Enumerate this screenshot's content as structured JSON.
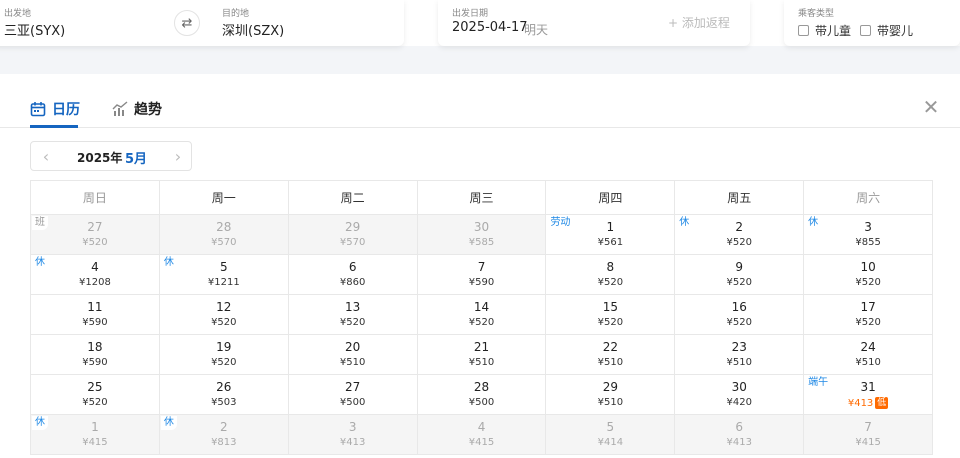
{
  "search": {
    "from_label": "出发地",
    "from_value": "三亚(SYX)",
    "to_label": "目的地",
    "to_value": "深圳(SZX)",
    "date_label": "出发日期",
    "date_value": "2025-04-17",
    "date_sub": "明天",
    "add_return": "+ 添加返程",
    "pax_label": "乘客类型",
    "pax_child": "带儿童",
    "pax_infant": "带婴儿"
  },
  "tabs": [
    {
      "label": "日历",
      "icon": "calendar-icon",
      "active": true
    },
    {
      "label": "趋势",
      "icon": "trend-icon",
      "active": false
    }
  ],
  "month_nav": {
    "year": "2025年",
    "month": "5月"
  },
  "weekdays": [
    "周日",
    "周一",
    "周二",
    "周三",
    "周四",
    "周五",
    "周六"
  ],
  "weeks": [
    [
      {
        "day": "27",
        "price": "¥520",
        "other": true,
        "tag": "班",
        "tagType": "work"
      },
      {
        "day": "28",
        "price": "¥570",
        "other": true
      },
      {
        "day": "29",
        "price": "¥570",
        "other": true
      },
      {
        "day": "30",
        "price": "¥585",
        "other": true
      },
      {
        "day": "1",
        "price": "¥561",
        "tag": "劳动",
        "tagType": "rest"
      },
      {
        "day": "2",
        "price": "¥520",
        "tag": "休",
        "tagType": "rest"
      },
      {
        "day": "3",
        "price": "¥855",
        "tag": "休",
        "tagType": "rest"
      }
    ],
    [
      {
        "day": "4",
        "price": "¥1208",
        "tag": "休",
        "tagType": "rest"
      },
      {
        "day": "5",
        "price": "¥1211",
        "tag": "休",
        "tagType": "rest"
      },
      {
        "day": "6",
        "price": "¥860"
      },
      {
        "day": "7",
        "price": "¥590"
      },
      {
        "day": "8",
        "price": "¥520"
      },
      {
        "day": "9",
        "price": "¥520"
      },
      {
        "day": "10",
        "price": "¥520"
      }
    ],
    [
      {
        "day": "11",
        "price": "¥590"
      },
      {
        "day": "12",
        "price": "¥520"
      },
      {
        "day": "13",
        "price": "¥520"
      },
      {
        "day": "14",
        "price": "¥520"
      },
      {
        "day": "15",
        "price": "¥520"
      },
      {
        "day": "16",
        "price": "¥520"
      },
      {
        "day": "17",
        "price": "¥520"
      }
    ],
    [
      {
        "day": "18",
        "price": "¥590"
      },
      {
        "day": "19",
        "price": "¥520"
      },
      {
        "day": "20",
        "price": "¥510"
      },
      {
        "day": "21",
        "price": "¥510"
      },
      {
        "day": "22",
        "price": "¥510"
      },
      {
        "day": "23",
        "price": "¥510"
      },
      {
        "day": "24",
        "price": "¥510"
      }
    ],
    [
      {
        "day": "25",
        "price": "¥520"
      },
      {
        "day": "26",
        "price": "¥503"
      },
      {
        "day": "27",
        "price": "¥500"
      },
      {
        "day": "28",
        "price": "¥500"
      },
      {
        "day": "29",
        "price": "¥510"
      },
      {
        "day": "30",
        "price": "¥420"
      },
      {
        "day": "31",
        "price": "¥413",
        "tag": "端午",
        "tagType": "rest",
        "lowest": true,
        "badge": "低"
      }
    ],
    [
      {
        "day": "1",
        "price": "¥415",
        "other": true,
        "tag": "休",
        "tagType": "rest"
      },
      {
        "day": "2",
        "price": "¥813",
        "other": true,
        "tag": "休",
        "tagType": "rest"
      },
      {
        "day": "3",
        "price": "¥413",
        "other": true
      },
      {
        "day": "4",
        "price": "¥415",
        "other": true
      },
      {
        "day": "5",
        "price": "¥414",
        "other": true
      },
      {
        "day": "6",
        "price": "¥413",
        "other": true
      },
      {
        "day": "7",
        "price": "¥415",
        "other": true
      }
    ]
  ],
  "colors": {
    "accent": "#1565c0",
    "rest_tag": "#1e88e5",
    "lowest": "#ff6a00"
  }
}
